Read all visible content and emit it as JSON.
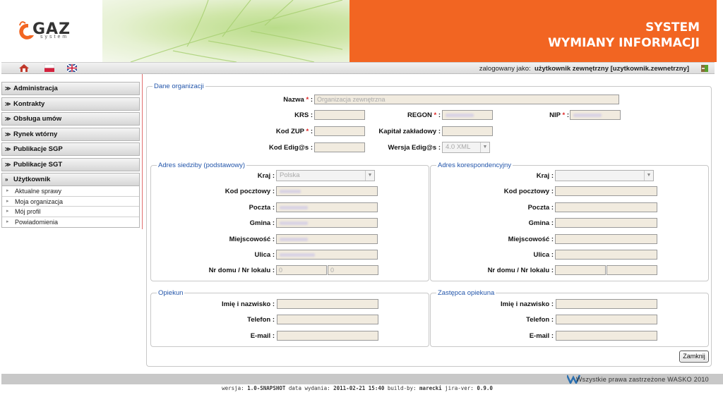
{
  "header": {
    "logo_text": "GAZ",
    "logo_sub": "system",
    "title_line1": "SYSTEM",
    "title_line2": "WYMIANY INFORMACJI",
    "accent_color": "#f26522"
  },
  "toolbar": {
    "icons": [
      "home-icon",
      "flag-pl-icon",
      "flag-en-icon",
      "logout-icon"
    ],
    "login_prefix": "zalogowany jako:",
    "login_user": "użytkownik zewnętrzny [uzytkownik.zewnetrzny]"
  },
  "sidebar": {
    "items": [
      {
        "label": "Administracja"
      },
      {
        "label": "Kontrakty"
      },
      {
        "label": "Obsługa umów"
      },
      {
        "label": "Rynek wtórny"
      },
      {
        "label": "Publikacje SGP"
      },
      {
        "label": "Publikacje SGT"
      },
      {
        "label": "Użytkownik"
      }
    ],
    "subitems": [
      {
        "label": "Aktualne sprawy"
      },
      {
        "label": "Moja organizacja"
      },
      {
        "label": "Mój profil"
      },
      {
        "label": "Powiadomienia"
      }
    ]
  },
  "org": {
    "legend": "Dane organizacji",
    "nazwa_label": "Nazwa",
    "nazwa_value": "Organizacja zewnętrzna",
    "krs_label": "KRS :",
    "regon_label": "REGON",
    "nip_label": "NIP",
    "kodzup_label": "Kod ZUP",
    "kapital_label": "Kapitał zakładowy :",
    "kodedig_label": "Kod Edig@s :",
    "wersja_label": "Wersja Edig@s :",
    "wersja_value": "4.0 XML",
    "req_mark": "*",
    "colon": " :"
  },
  "addr_main": {
    "legend": "Adres siedziby (podstawowy)",
    "kraj_label": "Kraj :",
    "kraj_value": "Polska",
    "kod_label": "Kod pocztowy :",
    "poczta_label": "Poczta :",
    "gmina_label": "Gmina :",
    "miejscowosc_label": "Miejscowość :",
    "ulica_label": "Ulica :",
    "nr_label": "Nr domu / Nr lokalu :",
    "nr_domu_value": "0",
    "nr_lokalu_value": "0"
  },
  "addr_corr": {
    "legend": "Adres korespondencyjny",
    "kraj_label": "Kraj :",
    "kod_label": "Kod pocztowy :",
    "poczta_label": "Poczta :",
    "gmina_label": "Gmina :",
    "miejscowosc_label": "Miejscowość :",
    "ulica_label": "Ulica :",
    "nr_label": "Nr domu / Nr lokalu :"
  },
  "opiekun": {
    "legend": "Opiekun",
    "imie_label": "Imię i nazwisko :",
    "telefon_label": "Telefon :",
    "email_label": "E-mail :"
  },
  "zastepca": {
    "legend": "Zastępca opiekuna",
    "imie_label": "Imię i nazwisko :",
    "telefon_label": "Telefon :",
    "email_label": "E-mail :"
  },
  "actions": {
    "close_label": "Zamknij"
  },
  "footer": {
    "copyright": "Wszystkie prawa zastrzeżone WASKO 2010",
    "version_prefix": "wersja:",
    "version": "1.0-SNAPSHOT",
    "date_prefix": "data wydania:",
    "date": "2011-02-21 15:40",
    "build_prefix": "build-by:",
    "build_by": "marecki",
    "jira_prefix": "jira-ver:",
    "jira_ver": "0.9.0"
  }
}
